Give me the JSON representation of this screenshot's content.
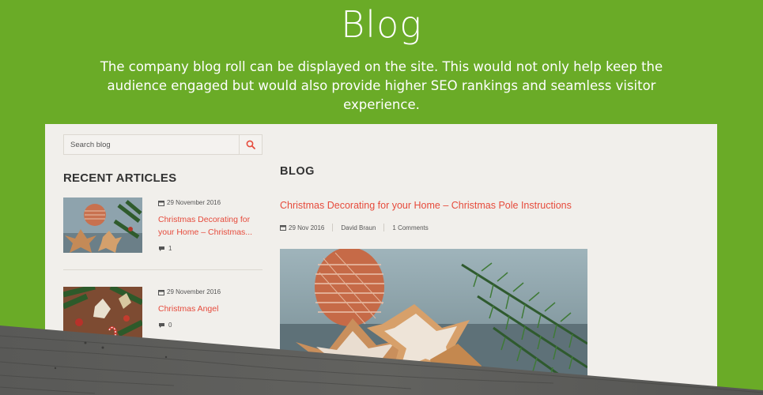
{
  "hero": {
    "title": "Blog",
    "description": "The company blog roll can be displayed on the site. This would not only help keep the audience engaged but would also provide higher SEO rankings and seamless visitor experience."
  },
  "sidebar": {
    "search_placeholder": "Search blog",
    "recent_title": "RECENT ARTICLES",
    "articles": [
      {
        "date": "29 November 2016",
        "title": "Christmas Decorating for your Home – Christmas...",
        "comments": "1"
      },
      {
        "date": "29 November 2016",
        "title": "Christmas Angel",
        "comments": "0"
      }
    ]
  },
  "main": {
    "heading": "BLOG",
    "post": {
      "title": "Christmas Decorating for your Home – Christmas Pole Instructions",
      "date": "29 Nov 2016",
      "author": "David Braun",
      "comments": "1 Comments"
    }
  },
  "colors": {
    "brand_green": "#6aab27",
    "accent_red": "#e64b3c",
    "panel_bg": "#f1efeb",
    "wood_gray": "#5b5b59"
  }
}
